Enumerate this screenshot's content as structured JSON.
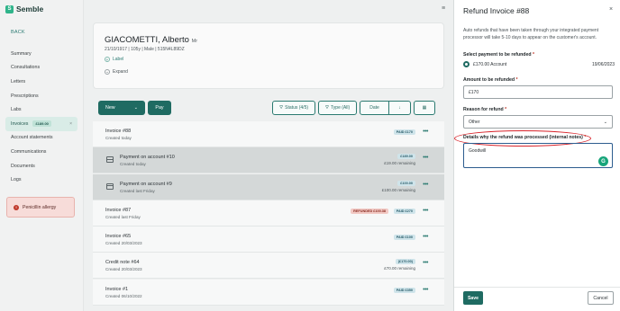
{
  "app": {
    "logo_letter": "S",
    "name": "Semble"
  },
  "sidebar": {
    "back": "BACK",
    "items": [
      {
        "label": "Summary"
      },
      {
        "label": "Consultations"
      },
      {
        "label": "Letters"
      },
      {
        "label": "Prescriptions"
      },
      {
        "label": "Labs"
      },
      {
        "label": "Invoices",
        "badge": "£189.00",
        "active": true
      },
      {
        "label": "Account statements"
      },
      {
        "label": "Communications"
      },
      {
        "label": "Documents"
      },
      {
        "label": "Logs"
      }
    ],
    "allergy": "Penicillin allergy"
  },
  "patient": {
    "name": "GIACOMETTI, Alberto",
    "title": "Mr",
    "meta": "21/10/1917  |  105y  |  Male  |  515N4L89DZ",
    "label_action": "Label",
    "expand_action": "Expand"
  },
  "toolbar": {
    "new": "New",
    "pay": "Pay",
    "status": "Status (4/5)",
    "type": "Type (All)",
    "date": "Date"
  },
  "rows": [
    {
      "title": "Invoice #88",
      "sub": "Created today",
      "badge": "PAID £170",
      "badge_kind": "paid"
    },
    {
      "title": "Payment on account #10",
      "sub": "Created today",
      "amount": "£189.00",
      "remaining": "£19.00 remaining",
      "highlight": true,
      "icon": true
    },
    {
      "title": "Payment on account #9",
      "sub": "Created last Friday",
      "amount": "£100.00",
      "remaining": "£100.00 remaining",
      "highlight": true,
      "icon": true
    },
    {
      "title": "Invoice #87",
      "sub": "Created last Friday",
      "badge": "PAID £270",
      "badge_kind": "paid",
      "badge2": "REFUNDED £100.38"
    },
    {
      "title": "Invoice #65",
      "sub": "Created 20/03/2023",
      "badge": "PAID £100",
      "badge_kind": "paid"
    },
    {
      "title": "Credit note #64",
      "sub": "Created 20/03/2023",
      "amount": "(£170.00)",
      "remaining": "£70.00 remaining"
    },
    {
      "title": "Invoice #1",
      "sub": "Created 06/10/2022",
      "badge": "PAID £350",
      "badge_kind": "paid"
    }
  ],
  "drawer": {
    "title": "Refund Invoice #88",
    "info": "Auto refunds that have been taken through your integrated payment processor will take 5-10 days to appear on the customer's account.",
    "payment_label": "Select payment to be refunded",
    "payment_option": "£170.00  Account",
    "payment_date": "19/06/2023",
    "amount_label": "Amount to be refunded",
    "amount_value": "£170",
    "reason_label": "Reason for refund",
    "reason_value": "Other",
    "notes_label": "Details why the refund was processed (internal notes)",
    "notes_value": "Goodwill",
    "save": "Save",
    "cancel": "Cancel"
  },
  "colors": {
    "brand": "#1f6b62",
    "accent_green": "#2fb48a",
    "annotation_red": "#d8232a"
  }
}
